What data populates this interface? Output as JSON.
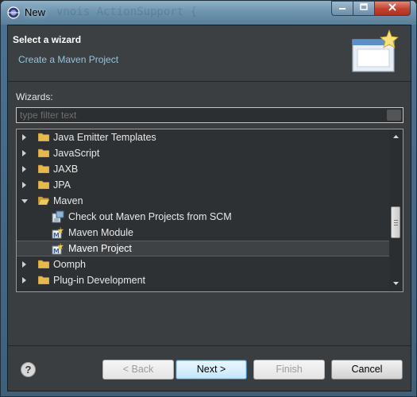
{
  "window": {
    "title": "New",
    "background_code": "vnois ActionSupport {"
  },
  "header": {
    "title": "Select a wizard",
    "description": "Create a Maven Project"
  },
  "wizards": {
    "label": "Wizards:",
    "filter_placeholder": "type filter text"
  },
  "tree": {
    "items": [
      {
        "label": "Java Emitter Templates",
        "kind": "folder",
        "state": "collapsed"
      },
      {
        "label": "JavaScript",
        "kind": "folder",
        "state": "collapsed"
      },
      {
        "label": "JAXB",
        "kind": "folder",
        "state": "collapsed"
      },
      {
        "label": "JPA",
        "kind": "folder",
        "state": "collapsed"
      },
      {
        "label": "Maven",
        "kind": "folder",
        "state": "expanded"
      },
      {
        "label": "Check out Maven Projects from SCM",
        "kind": "scm-checkout-icon"
      },
      {
        "label": "Maven Module",
        "kind": "maven-module-icon"
      },
      {
        "label": "Maven Project",
        "kind": "maven-project-icon",
        "selected": true
      },
      {
        "label": "Oomph",
        "kind": "folder",
        "state": "collapsed"
      },
      {
        "label": "Plug-in Development",
        "kind": "folder",
        "state": "collapsed"
      }
    ]
  },
  "buttons": {
    "help": "?",
    "back": "< Back",
    "next": "Next >",
    "finish": "Finish",
    "cancel": "Cancel"
  },
  "colors": {
    "description_link": "#8fc6e0",
    "folder": "#e8b84a",
    "close_button": "#c2402c"
  }
}
